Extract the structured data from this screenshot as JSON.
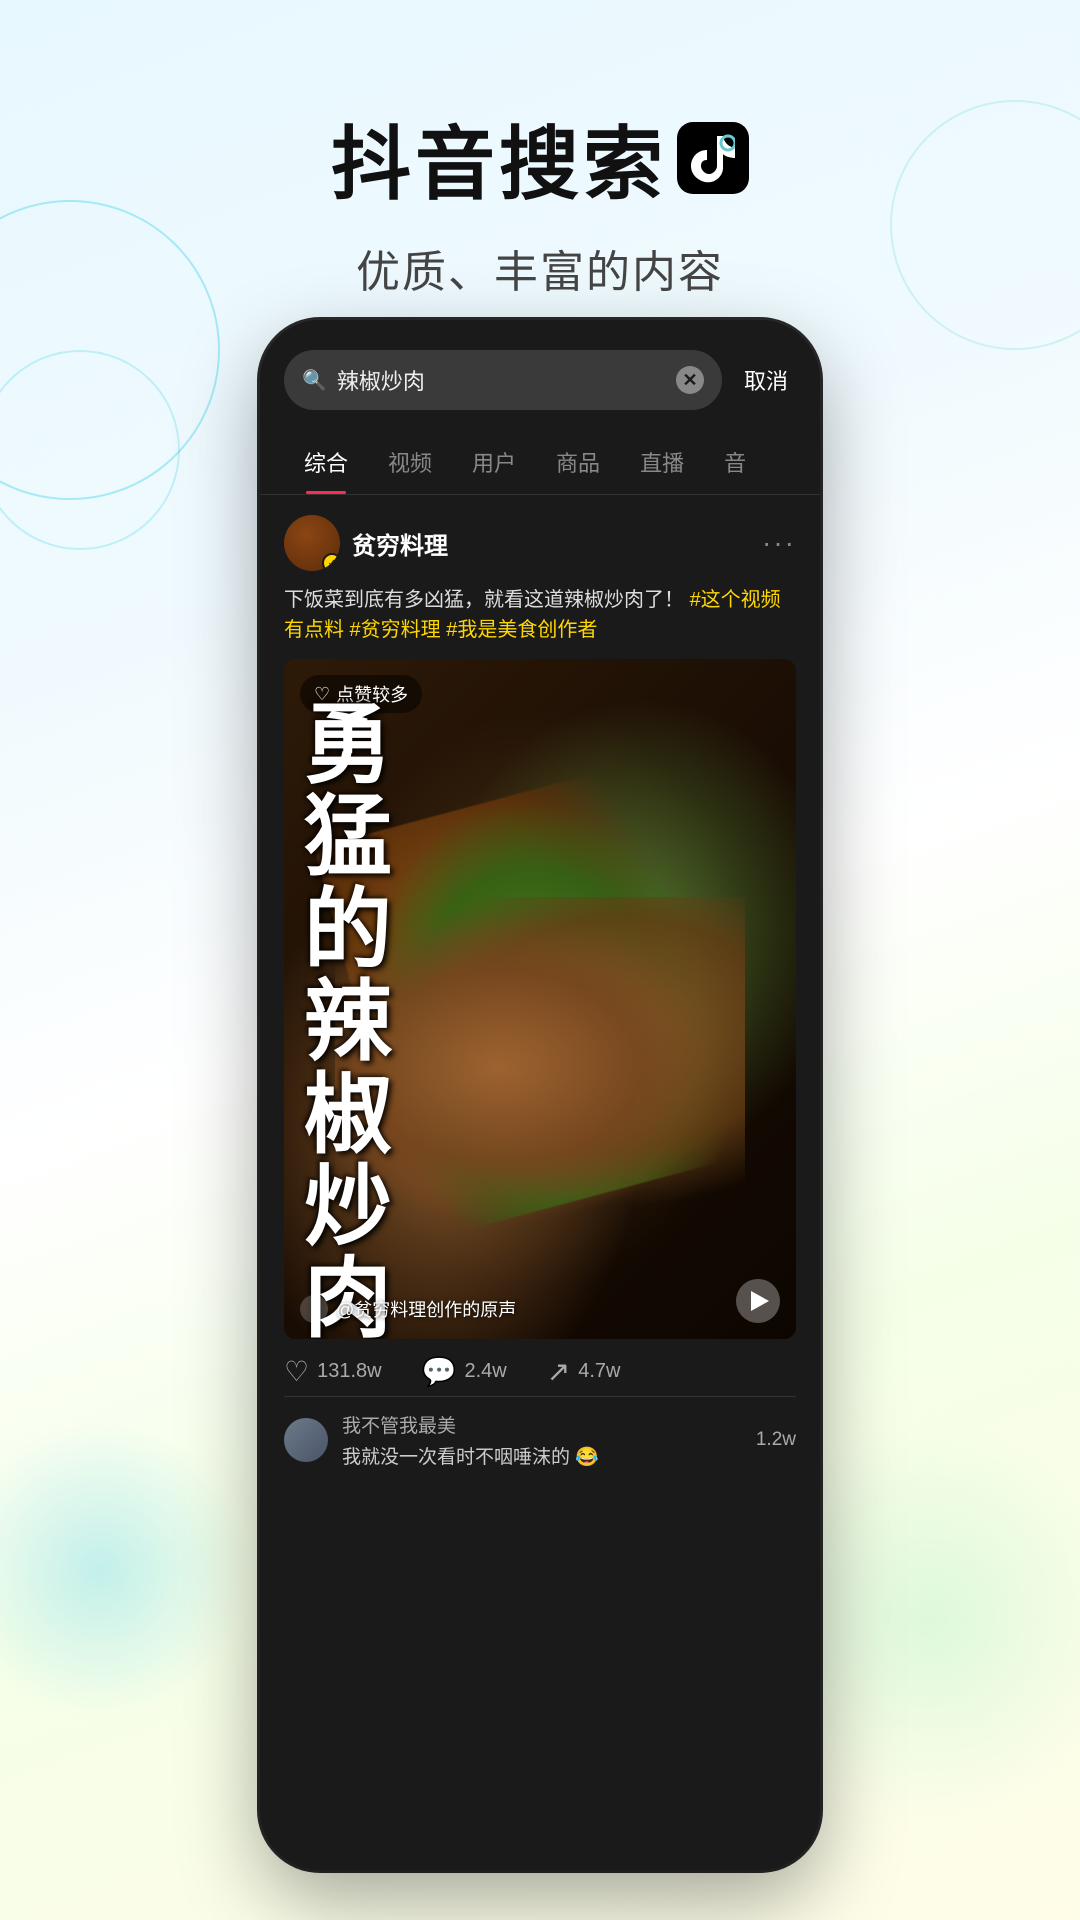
{
  "header": {
    "main_title": "抖音搜索",
    "subtitle": "优质、丰富的内容",
    "tiktok_logo_alt": "TikTok logo"
  },
  "phone": {
    "search": {
      "query": "辣椒炒肉",
      "placeholder": "搜索",
      "clear_btn_label": "×",
      "cancel_label": "取消"
    },
    "tabs": [
      {
        "id": "comprehensive",
        "label": "综合",
        "active": true
      },
      {
        "id": "video",
        "label": "视频",
        "active": false
      },
      {
        "id": "user",
        "label": "用户",
        "active": false
      },
      {
        "id": "product",
        "label": "商品",
        "active": false
      },
      {
        "id": "live",
        "label": "直播",
        "active": false
      },
      {
        "id": "audio",
        "label": "音",
        "active": false
      }
    ],
    "post": {
      "author": {
        "name": "贫穷料理",
        "verified": true,
        "avatar_alt": "贫穷料理 avatar"
      },
      "description": "下饭菜到底有多凶猛，就看这道辣椒炒肉了！",
      "tags": "#这个视频有点料 #贫穷料理 #我是美食创作者",
      "video": {
        "hot_badge": "点赞较多",
        "text_overlay": "勇猛的辣椒炒肉",
        "text_line1": "勇",
        "text_line2": "猛",
        "text_line3": "的",
        "text_line4": "辣",
        "text_line5": "椒",
        "text_line6": "炒",
        "text_line7": "肉",
        "music_info": "@贫穷料理创作的原声",
        "play_btn_label": "play"
      },
      "interactions": {
        "likes": "131.8w",
        "comments": "2.4w",
        "shares": "4.7w"
      },
      "comment_preview": {
        "user": "我不管我最美",
        "text": "我就没一次看时不咽唾沫的 😂",
        "count": "1.2w"
      }
    }
  }
}
